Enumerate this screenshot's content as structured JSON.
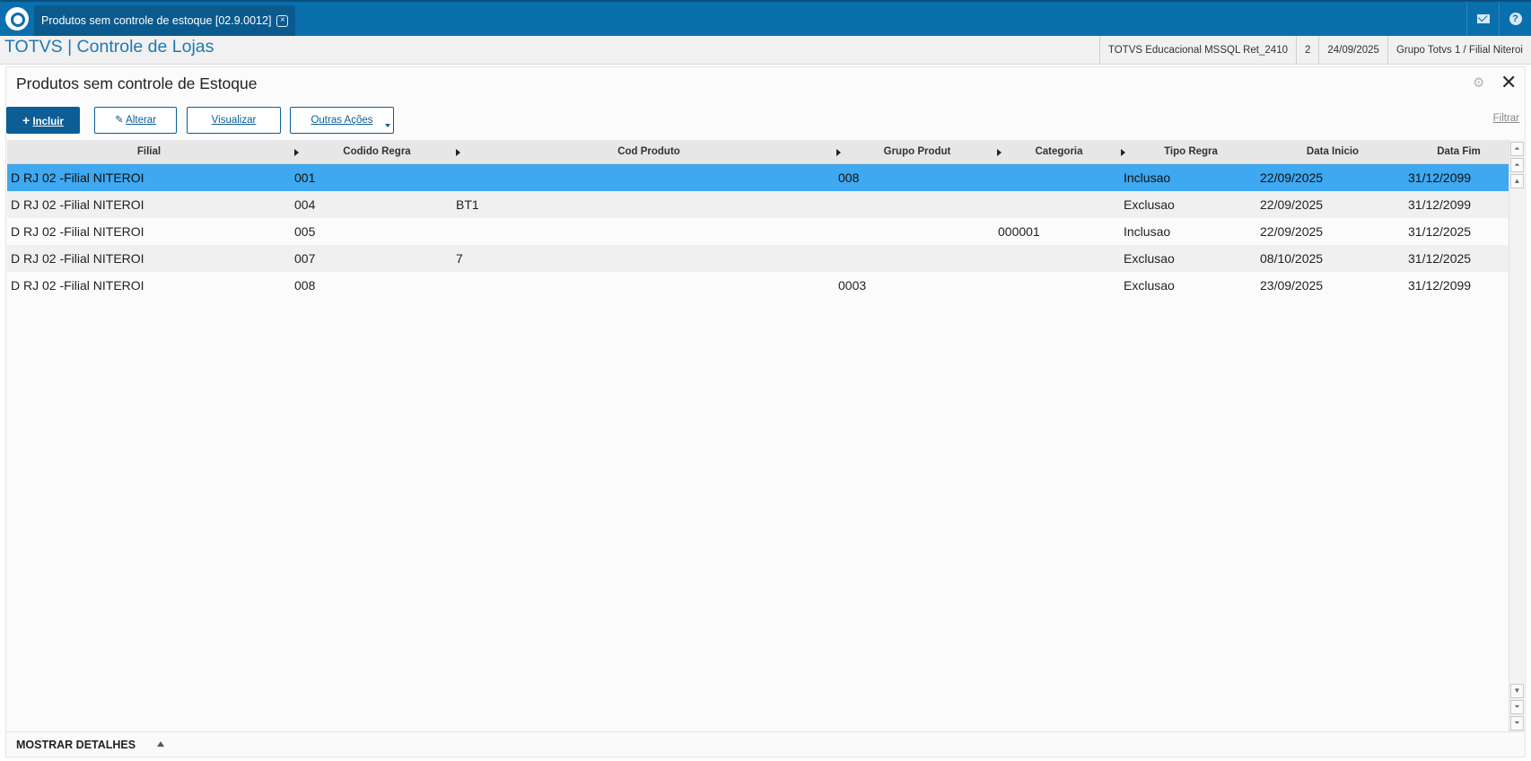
{
  "tab": {
    "title": "Produtos sem controle de estoque [02.9.0012]",
    "close_glyph": "×"
  },
  "brand": "TOTVS | Controle de Lojas",
  "info": [
    "TOTVS Educacional MSSQL Ret_2410",
    "2",
    "24/09/2025",
    "Grupo Totvs 1 / Filial Niteroi"
  ],
  "page_title": "Produtos sem controle de Estoque",
  "actions": {
    "incluir": "Incluir",
    "alterar": "Alterar",
    "visualizar": "Visualizar",
    "outras": "Outras Ações",
    "filtrar": "Filtrar"
  },
  "columns": [
    "Filial",
    "Codido Regra",
    "Cod Produto",
    "Grupo Produt",
    "Categoria",
    "Tipo Regra",
    "Data Inicio",
    "Data Fim"
  ],
  "rows": [
    [
      "D RJ 02 -Filial NITEROI",
      "001",
      "",
      "008",
      "",
      "Inclusao",
      "22/09/2025",
      "31/12/2099"
    ],
    [
      "D RJ 02 -Filial NITEROI",
      "004",
      "BT1",
      "",
      "",
      "Exclusao",
      "22/09/2025",
      "31/12/2099"
    ],
    [
      "D RJ 02 -Filial NITEROI",
      "005",
      "",
      "",
      "000001",
      "Inclusao",
      "22/09/2025",
      "31/12/2025"
    ],
    [
      "D RJ 02 -Filial NITEROI",
      "007",
      "7",
      "",
      "",
      "Exclusao",
      "08/10/2025",
      "31/12/2025"
    ],
    [
      "D RJ 02 -Filial NITEROI",
      "008",
      "",
      "0003",
      "",
      "Exclusao",
      "23/09/2025",
      "31/12/2099"
    ]
  ],
  "footer": {
    "label": "MOSTRAR DETALHES"
  },
  "colors": {
    "topbar": "#0a6fad",
    "primary": "#0b5e96",
    "selected_row": "#3ea8f0",
    "brand_text": "#1f78b4"
  },
  "icons": [
    "logo-icon",
    "close-tab-icon",
    "mail-icon",
    "help-icon",
    "gear-icon",
    "close-icon",
    "plus-icon",
    "pencil-icon",
    "caret-down-icon",
    "sort-arrow-icon",
    "scroll-top-icon",
    "scroll-up-icon",
    "scroll-down-icon",
    "scroll-bottom-icon",
    "expand-up-icon"
  ]
}
